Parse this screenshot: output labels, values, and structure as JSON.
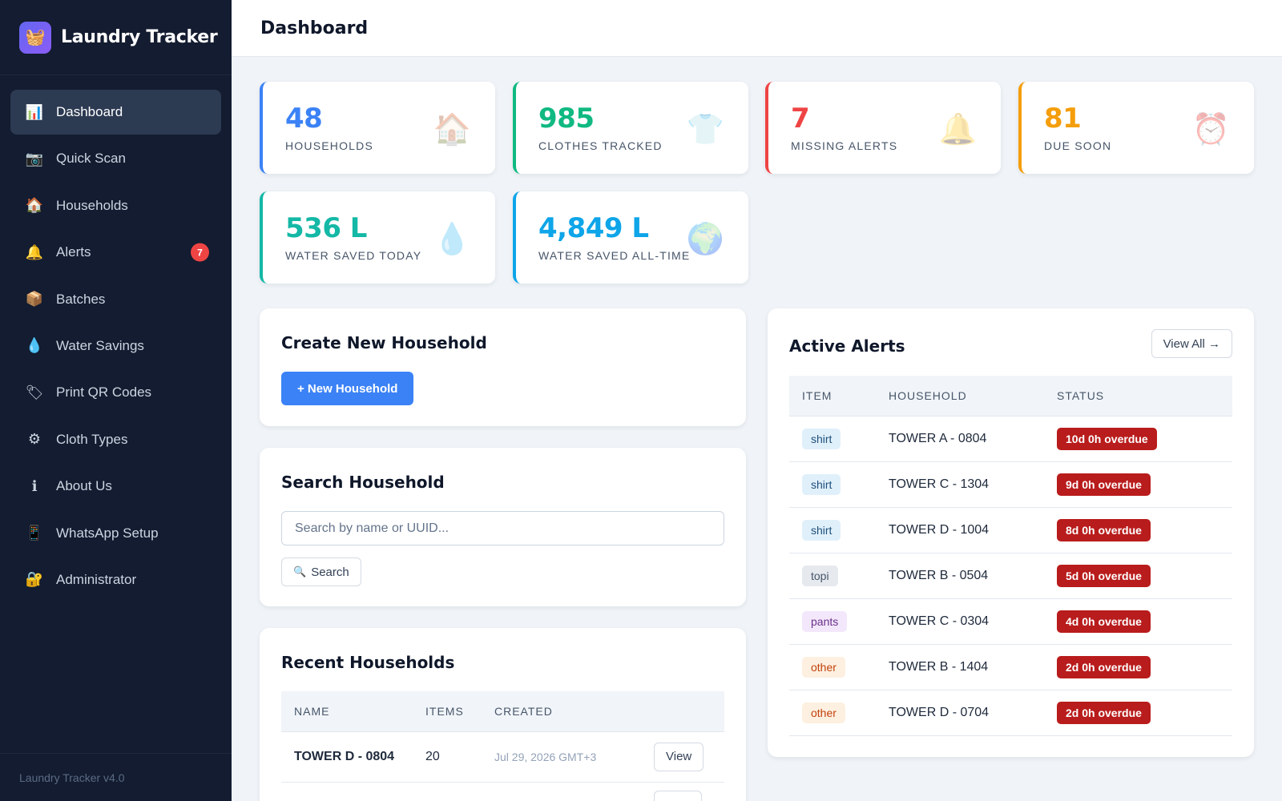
{
  "app": {
    "name": "Laundry Tracker",
    "logo_icon": "🧺",
    "version": "Laundry Tracker v4.0"
  },
  "sidebar": {
    "items": [
      {
        "label": "Dashboard",
        "icon": "📊"
      },
      {
        "label": "Quick Scan",
        "icon": "📷"
      },
      {
        "label": "Households",
        "icon": "🏠"
      },
      {
        "label": "Alerts",
        "icon": "🔔",
        "badge": "7"
      },
      {
        "label": "Batches",
        "icon": "📦"
      },
      {
        "label": "Water Savings",
        "icon": "💧"
      },
      {
        "label": "Print QR Codes",
        "icon": "🏷"
      },
      {
        "label": "Cloth Types",
        "icon": "⚙"
      },
      {
        "label": "About Us",
        "icon": "ℹ"
      },
      {
        "label": "WhatsApp Setup",
        "icon": "📱"
      },
      {
        "label": "Administrator",
        "icon": "🔐"
      }
    ]
  },
  "header": {
    "title": "Dashboard"
  },
  "stats": [
    {
      "value": "48",
      "label": "Households",
      "icon": "🏠",
      "color": "#3b82f6"
    },
    {
      "value": "985",
      "label": "Clothes Tracked",
      "icon": "👕",
      "color": "#10b981"
    },
    {
      "value": "7",
      "label": "Missing Alerts",
      "icon": "🔔",
      "color": "#ef4444"
    },
    {
      "value": "81",
      "label": "Due Soon",
      "icon": "⏰",
      "color": "#f59e0b"
    },
    {
      "value": "536 L",
      "label": "Water Saved Today",
      "icon": "💧",
      "color": "#14b8a6"
    },
    {
      "value": "4,849 L",
      "label": "Water Saved All-Time",
      "icon": "🌍",
      "color": "#0ea5e9"
    }
  ],
  "create_household": {
    "title": "Create New Household",
    "button": "+ New Household"
  },
  "search_household": {
    "title": "Search Household",
    "placeholder": "Search by name or UUID...",
    "button": "Search",
    "button_icon": "🔍"
  },
  "recent_households": {
    "title": "Recent Households",
    "columns": [
      "NAME",
      "ITEMS",
      "CREATED"
    ],
    "rows": [
      {
        "name": "TOWER D - 0804",
        "items": "20",
        "created": "Jul 29, 2026 GMT+3",
        "action": "View"
      }
    ]
  },
  "active_alerts": {
    "title": "Active Alerts",
    "view_all": "View All →",
    "columns": [
      "ITEM",
      "HOUSEHOLD",
      "STATUS"
    ],
    "rows": [
      {
        "item": "shirt",
        "tag": "blue",
        "household": "TOWER A - 0804",
        "status": "10d 0h overdue"
      },
      {
        "item": "shirt",
        "tag": "blue",
        "household": "TOWER C - 1304",
        "status": "9d 0h overdue"
      },
      {
        "item": "shirt",
        "tag": "blue",
        "household": "TOWER D - 1004",
        "status": "8d 0h overdue"
      },
      {
        "item": "topi",
        "tag": "gray",
        "household": "TOWER B - 0504",
        "status": "5d 0h overdue"
      },
      {
        "item": "pants",
        "tag": "purple",
        "household": "TOWER C - 0304",
        "status": "4d 0h overdue"
      },
      {
        "item": "other",
        "tag": "orange",
        "household": "TOWER B - 1404",
        "status": "2d 0h overdue"
      },
      {
        "item": "other",
        "tag": "orange",
        "household": "TOWER D - 0704",
        "status": "2d 0h overdue"
      }
    ]
  }
}
